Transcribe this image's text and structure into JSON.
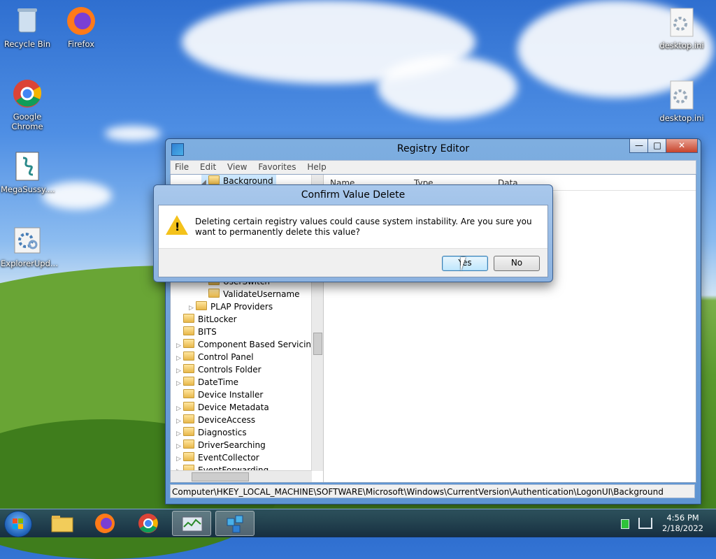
{
  "desktop": {
    "icons": [
      {
        "label": "Recycle Bin",
        "icon": "recycle-bin-icon"
      },
      {
        "label": "Firefox",
        "icon": "firefox-icon"
      },
      {
        "label": "Google Chrome",
        "icon": "chrome-icon"
      },
      {
        "label": "MegaSussy....",
        "icon": "batch-file-icon"
      },
      {
        "label": "ExplorerUpd...",
        "icon": "settings-file-icon"
      },
      {
        "label": "desktop.ini",
        "icon": "settings-file-icon"
      },
      {
        "label": "desktop.ini",
        "icon": "settings-file-icon"
      }
    ]
  },
  "regedit": {
    "title": "Registry Editor",
    "buttons": {
      "minimize": "—",
      "maximize": "□",
      "close": "✕"
    },
    "menu": [
      "File",
      "Edit",
      "View",
      "Favorites",
      "Help"
    ],
    "tree": [
      {
        "label": "Background",
        "expanded": true,
        "selected": true
      },
      {
        "label": "UserSwitch"
      },
      {
        "label": "ValidateUsername"
      },
      {
        "label": "PLAP Providers"
      },
      {
        "label": "BitLocker"
      },
      {
        "label": "BITS"
      },
      {
        "label": "Component Based Servicing"
      },
      {
        "label": "Control Panel"
      },
      {
        "label": "Controls Folder"
      },
      {
        "label": "DateTime"
      },
      {
        "label": "Device Installer"
      },
      {
        "label": "Device Metadata"
      },
      {
        "label": "DeviceAccess"
      },
      {
        "label": "Diagnostics"
      },
      {
        "label": "DriverSearching"
      },
      {
        "label": "EventCollector"
      },
      {
        "label": "EventForwarding"
      }
    ],
    "columns": [
      "Name",
      "Type",
      "Data"
    ],
    "status_path": "Computer\\HKEY_LOCAL_MACHINE\\SOFTWARE\\Microsoft\\Windows\\CurrentVersion\\Authentication\\LogonUI\\Background"
  },
  "dialog": {
    "title": "Confirm Value Delete",
    "message": "Deleting certain registry values could cause system instability. Are you sure you want to permanently delete this value?",
    "yes": "Yes",
    "no": "No"
  },
  "taskbar": {
    "time": "4:56 PM",
    "date": "2/18/2022",
    "items": [
      "start-button",
      "file-explorer-icon",
      "firefox-icon",
      "chrome-icon",
      "task-manager-icon",
      "regedit-icon"
    ]
  },
  "colors": {
    "accent": "#5e94d2",
    "warning": "#f4c21b",
    "folder": "#e8b84a"
  }
}
